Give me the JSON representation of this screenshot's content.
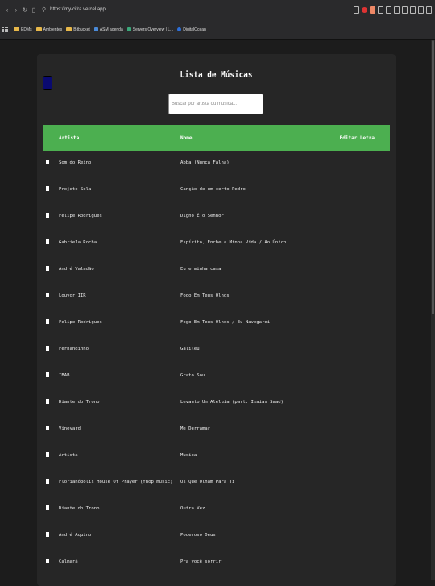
{
  "browser": {
    "url": "https://my-cifra.vercel.app",
    "bookmarks": [
      {
        "label": "EDMs",
        "kind": "folder"
      },
      {
        "label": "Ambientes",
        "kind": "folder"
      },
      {
        "label": "Bitbucket",
        "kind": "folder"
      },
      {
        "label": "ASM agenda",
        "kind": "fav"
      },
      {
        "label": "Servers Overview | L...",
        "kind": "fav-green"
      },
      {
        "label": "DigitalOcean",
        "kind": "fav-blue"
      }
    ]
  },
  "page": {
    "title": "Lista de Músicas",
    "search_placeholder": "Buscar por artista ou música..."
  },
  "table": {
    "headers": {
      "artist": "Artista",
      "name": "Nome",
      "edit": "Editar Letra"
    },
    "rows": [
      {
        "artist": "Som do Reino",
        "song": "Abba (Nunca Falha)"
      },
      {
        "artist": "Projeto Sola",
        "song": "Canção de um certo Pedro"
      },
      {
        "artist": "Felipe Rodrigues",
        "song": "Digno É o Senhor"
      },
      {
        "artist": "Gabriela Rocha",
        "song": "Espírito, Enche a Minha Vida / Ao Único"
      },
      {
        "artist": "André Valadão",
        "song": "Eu e minha casa"
      },
      {
        "artist": "Louvor IIR",
        "song": "Fogo Em Teus Olhos"
      },
      {
        "artist": "Felipe Rodrigues",
        "song": "Fogo Em Teus Olhos / Eu Navegarei"
      },
      {
        "artist": "Fernandinho",
        "song": "Galileu"
      },
      {
        "artist": "IBAB",
        "song": "Grato Sou"
      },
      {
        "artist": "Diante do Trono",
        "song": "Levanto Um Aleluia (part. Isaias Saad)"
      },
      {
        "artist": "Vineyard",
        "song": "Me Derramar"
      },
      {
        "artist": "Artista",
        "song": "Musica"
      },
      {
        "artist": "Florianópolis House Of Prayer (fhop music)",
        "song": "Os Que Olham Para Ti"
      },
      {
        "artist": "Diante do Trono",
        "song": "Outra Vez"
      },
      {
        "artist": "André Aquino",
        "song": "Poderoso Deus"
      },
      {
        "artist": "Calmará",
        "song": "Pra você sorrir"
      }
    ]
  }
}
